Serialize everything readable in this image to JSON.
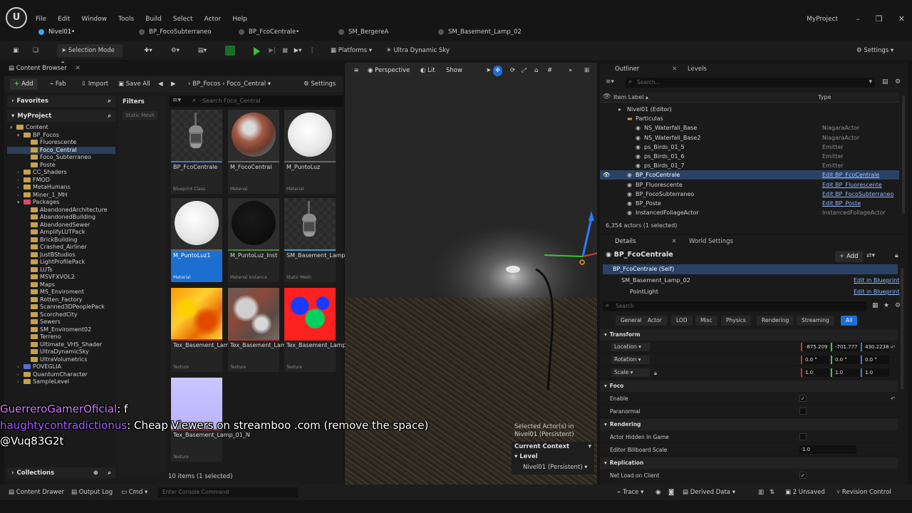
{
  "app": {
    "logo": "U",
    "menu": [
      "File",
      "Edit",
      "Window",
      "Tools",
      "Build",
      "Select",
      "Actor",
      "Help"
    ],
    "project_name": "MyProject"
  },
  "tabs": [
    {
      "label": "Nivel01•",
      "active": true
    },
    {
      "label": "BP_FocoSubterraneo",
      "active": false
    },
    {
      "label": "BP_FcoCentrale•",
      "active": false
    },
    {
      "label": "SM_BergereA",
      "active": false
    },
    {
      "label": "SM_Basement_Lamp_02",
      "active": false
    }
  ],
  "toolbar": {
    "mode_label": "Selection Mode",
    "platforms_label": "Platforms",
    "sky_label": "Ultra Dynamic Sky",
    "settings_label": "Settings"
  },
  "content_browser": {
    "title": "Content Browser",
    "add_label": "Add",
    "fab_label": "Fab",
    "import_label": "Import",
    "save_all_label": "Save All",
    "breadcrumb": [
      "BP_Focos",
      "Foco_Central"
    ],
    "settings_label": "Settings",
    "favorites_label": "Favorites",
    "project_label": "MyProject",
    "filters_label": "Filters",
    "filter_chip": "Static Mesh",
    "search_placeholder": "Search Foco_Central",
    "collections_label": "Collections",
    "footer": "10 items (1 selected)",
    "tree": [
      {
        "label": "Content",
        "depth": 0,
        "expanded": true,
        "color": "normal"
      },
      {
        "label": "BP_Focos",
        "depth": 1,
        "expanded": true,
        "color": "normal"
      },
      {
        "label": "Fluorescente",
        "depth": 2,
        "color": "normal"
      },
      {
        "label": "Foco_Central",
        "depth": 2,
        "color": "normal",
        "selected": true
      },
      {
        "label": "Foco_Subterraneo",
        "depth": 2,
        "color": "normal"
      },
      {
        "label": "Poste",
        "depth": 2,
        "color": "normal"
      },
      {
        "label": "CC_Shaders",
        "depth": 1,
        "color": "normal"
      },
      {
        "label": "FMOD",
        "depth": 1,
        "color": "normal"
      },
      {
        "label": "MetaHumans",
        "depth": 1,
        "color": "normal"
      },
      {
        "label": "Miner_1_MH",
        "depth": 1,
        "color": "normal"
      },
      {
        "label": "Packages",
        "depth": 1,
        "expanded": true,
        "color": "pink"
      },
      {
        "label": "AbandonedArchitecture",
        "depth": 2,
        "color": "normal"
      },
      {
        "label": "AbandonedBuilding",
        "depth": 2,
        "color": "normal"
      },
      {
        "label": "AbandonedSewer",
        "depth": 2,
        "color": "normal"
      },
      {
        "label": "AmplifyLUTPack",
        "depth": 2,
        "color": "normal"
      },
      {
        "label": "BrickBuilding",
        "depth": 2,
        "color": "normal"
      },
      {
        "label": "Crashed_Airliner",
        "depth": 2,
        "color": "normal"
      },
      {
        "label": "JustBStudios",
        "depth": 2,
        "color": "normal"
      },
      {
        "label": "LightProfilePack",
        "depth": 2,
        "color": "normal"
      },
      {
        "label": "LUTs",
        "depth": 2,
        "color": "normal"
      },
      {
        "label": "MSVFXVOL2",
        "depth": 2,
        "color": "normal"
      },
      {
        "label": "Maps",
        "depth": 2,
        "color": "normal"
      },
      {
        "label": "MS_Enviroment",
        "depth": 2,
        "color": "normal"
      },
      {
        "label": "Rotten_Factory",
        "depth": 2,
        "color": "normal"
      },
      {
        "label": "Scanned3DPeoplePack",
        "depth": 2,
        "color": "normal"
      },
      {
        "label": "ScorchedCity",
        "depth": 2,
        "color": "normal"
      },
      {
        "label": "Sewers",
        "depth": 2,
        "color": "normal"
      },
      {
        "label": "SM_Enviroment02",
        "depth": 2,
        "color": "normal"
      },
      {
        "label": "Terreno",
        "depth": 2,
        "color": "normal"
      },
      {
        "label": "Ultimate_VHS_Shader",
        "depth": 2,
        "color": "normal"
      },
      {
        "label": "UltraDynamicSky",
        "depth": 2,
        "color": "normal"
      },
      {
        "label": "UltraVolumetrics",
        "depth": 2,
        "color": "normal"
      },
      {
        "label": "POVEGLIA",
        "depth": 1,
        "color": "blue"
      },
      {
        "label": "QuantumCharacter",
        "depth": 1,
        "color": "normal"
      },
      {
        "label": "SampleLevel",
        "depth": 1,
        "color": "normal"
      }
    ],
    "assets": [
      {
        "name": "BP_FcoCentrale",
        "type": "Blueprint Class",
        "thumb": "lamp",
        "bar": "#3c7ad6"
      },
      {
        "name": "M_FocoCentral",
        "type": "Material",
        "thumb": "rust-sphere",
        "bar": "#6a6a6a"
      },
      {
        "name": "M_PuntoLuz",
        "type": "Material",
        "thumb": "white-sphere",
        "bar": "#6a6a6a"
      },
      {
        "name": "M_PuntoLuz1",
        "type": "Material",
        "thumb": "white-sphere",
        "bar": "#6a6a6a",
        "selected": true
      },
      {
        "name": "M_PuntoLuz_Inst",
        "type": "Material Instance",
        "thumb": "black-sphere",
        "bar": "#4a8a3a"
      },
      {
        "name": "SM_Basement_Lamp_02",
        "type": "Static Mesh",
        "thumb": "lamp",
        "bar": "#3fa0c8"
      },
      {
        "name": "Tex_Basement_Lamp_01_ARM",
        "type": "Texture",
        "thumb": "tex-arm",
        "bar": "#c03030"
      },
      {
        "name": "Tex_Basement_Lamp_01_D",
        "type": "Texture",
        "thumb": "tex-d",
        "bar": "#c03030"
      },
      {
        "name": "Tex_Basement_Lamp_01_ID",
        "type": "Texture",
        "thumb": "tex-id",
        "bar": "#c03030"
      },
      {
        "name": "Tex_Basement_Lamp_01_N",
        "type": "Texture",
        "thumb": "tex-n",
        "bar": "#c03030"
      }
    ]
  },
  "viewport": {
    "perspective_label": "Perspective",
    "lit_label": "Lit",
    "show_label": "Show",
    "selected_info": "Selected Actor(s) in",
    "selected_level": "Nivel01 (Persistent)",
    "current_context_label": "Current Context",
    "level_label": "Level",
    "level_value": "Nivel01 (Persistent)"
  },
  "outliner": {
    "title": "Outliner",
    "levels_tab": "Levels",
    "search_placeholder": "Search...",
    "col_label": "Item Label ▴",
    "col_type": "Type",
    "rows": [
      {
        "label": "Nivel01 (Editor)",
        "type": "",
        "indent": 2
      },
      {
        "label": "Particulas",
        "type": "",
        "indent": 3,
        "folder": true
      },
      {
        "label": "NS_Waterfall_Base",
        "type": "NiagaraActor",
        "indent": 4
      },
      {
        "label": "NS_Waterfall_Base2",
        "type": "NiagaraActor",
        "indent": 4
      },
      {
        "label": "ps_Birds_01_5",
        "type": "Emitter",
        "indent": 4
      },
      {
        "label": "ps_Birds_01_6",
        "type": "Emitter",
        "indent": 4
      },
      {
        "label": "ps_Birds_01_7",
        "type": "Emitter",
        "indent": 4
      },
      {
        "label": "BP_FcoCentrale",
        "type": "Edit BP_FcoCentrale",
        "indent": 3,
        "link": true,
        "selected": true
      },
      {
        "label": "BP_Fluorescente",
        "type": "Edit BP_Fluorescente",
        "indent": 3,
        "link": true
      },
      {
        "label": "BP_FocoSubterraneo",
        "type": "Edit BP_FocoSubterraneo",
        "indent": 3,
        "link": true
      },
      {
        "label": "BP_Poste",
        "type": "Edit BP_Poste",
        "indent": 3,
        "link": true
      },
      {
        "label": "InstancedFoliageActor",
        "type": "InstancedFoliageActor",
        "indent": 3
      }
    ],
    "footer": "6,354 actors (1 selected)"
  },
  "details": {
    "title": "Details",
    "world_settings_tab": "World Settings",
    "actor_name": "BP_FcoCentrale",
    "add_label": "Add",
    "components": [
      {
        "label": "BP_FcoCentrale (Self)",
        "action": "",
        "indent": 0,
        "selected": true
      },
      {
        "label": "SM_Basement_Lamp_02",
        "action": "Edit in Blueprint",
        "indent": 1
      },
      {
        "label": "PointLight",
        "action": "Edit in Blueprint",
        "indent": 2
      }
    ],
    "search_placeholder": "Search",
    "filter_tabs": [
      "General",
      "Actor",
      "LOD",
      "Misc",
      "Physics",
      "Rendering",
      "Streaming",
      "All"
    ],
    "active_filter": "All",
    "sections": {
      "transform": "Transform",
      "foco": "Foco",
      "rendering": "Rendering",
      "replication": "Replication"
    },
    "transform": {
      "location_label": "Location",
      "location": [
        "-875.209",
        "-701.777",
        "430.2238"
      ],
      "rotation_label": "Rotation",
      "rotation": [
        "0.0 °",
        "0.0 °",
        "0.0 °"
      ],
      "scale_label": "Scale",
      "scale": [
        "1.0",
        "1.0",
        "1.0"
      ]
    },
    "foco": {
      "enable_label": "Enable",
      "enable": true,
      "paranormal_label": "Paranormal",
      "paranormal": false
    },
    "rendering": {
      "hidden_label": "Actor Hidden In Game",
      "hidden": false,
      "billboard_label": "Editor Billboard Scale",
      "billboard_value": "1.0"
    },
    "replication": {
      "net_load_label": "Net Load on Client",
      "net_load": true
    }
  },
  "statusbar": {
    "content_drawer": "Content Drawer",
    "output_log": "Output Log",
    "cmd": "Cmd",
    "console_placeholder": "Enter Console Command",
    "trace": "Trace",
    "derived_data": "Derived Data",
    "unsaved": "2 Unsaved",
    "revision_control": "Revision Control"
  },
  "chat": [
    {
      "user": "GuerreroGamerOficial",
      "text": ": f"
    },
    {
      "user": "haughtycontradictionus",
      "text": ": Cheap Viewers on streamboo .com (remove the space)"
    },
    {
      "user": "",
      "text": "@Vuq83G2t"
    }
  ]
}
